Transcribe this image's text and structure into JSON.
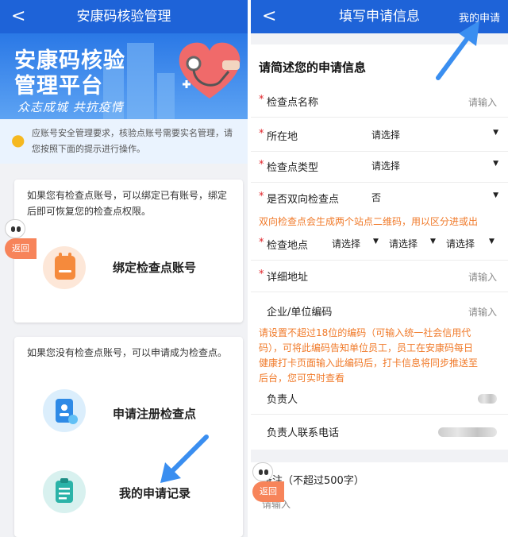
{
  "left": {
    "nav_back": "<",
    "nav_title": "安康码核验管理",
    "banner": {
      "title_line1": "安康码核验",
      "title_line2": "管理平台",
      "slogan": "众志成城 共抗疫情"
    },
    "notice": {
      "line1": "应账号安全管理要求，核验点账号需要实名管理，请",
      "line2": "您按照下面的提示进行操作。"
    },
    "card_bind": {
      "desc_line1": "如果您有检查点账号，可以绑定已有账号，绑定",
      "desc_line2": "后即可恢复您的检查点权限。",
      "action_label": "绑定检查点账号"
    },
    "card_apply": {
      "desc": "如果您没有检查点账号，可以申请成为检查点。",
      "register_label": "申请注册检查点",
      "records_label": "我的申请记录"
    },
    "float_back": "返回"
  },
  "right": {
    "nav_back": "<",
    "nav_title": "填写申请信息",
    "nav_right": "我的申请",
    "form_heading": "请简述您的申请信息",
    "required_mark": "*",
    "fields": {
      "checkpoint_name": {
        "label": "检查点名称",
        "placeholder": "请输入"
      },
      "location": {
        "label": "所在地",
        "value": "请选择"
      },
      "checkpoint_type": {
        "label": "检查点类型",
        "value": "请选择"
      },
      "two_way": {
        "label": "是否双向检查点",
        "value": "否"
      },
      "checkpoint_address": {
        "label": "检查地点",
        "value1": "请选择",
        "value2": "请选择",
        "value3": "请选择"
      },
      "detail_address": {
        "label": "详细地址",
        "placeholder": "请输入"
      },
      "company_code": {
        "label": "企业/单位编码",
        "placeholder": "请输入"
      },
      "person_in_charge": {
        "label": "负责人"
      },
      "contact_phone": {
        "label": "负责人联系电话"
      },
      "remarks": {
        "label": "备注（不超过500字）",
        "placeholder": "请输入"
      }
    },
    "hint_two_way": "双向检查点会生成两个站点二维码，用以区分进或出",
    "hint_code": {
      "line1": "请设置不超过18位的编码（可输入统一社会信用代",
      "line2": "码），可将此编码告知单位员工，员工在安康码每日",
      "line3": "健康打卡页面输入此编码后，打卡信息将同步推送至",
      "line4": "后台，您可实时查看"
    },
    "caret": "▼",
    "float_back": "返回"
  },
  "colors": {
    "nav_blue": "#1e63d8",
    "required_red": "#e0252b",
    "hint_orange": "#f07a2a",
    "fab_orange": "#f7845a",
    "arrow_blue": "#3a8ef0"
  }
}
